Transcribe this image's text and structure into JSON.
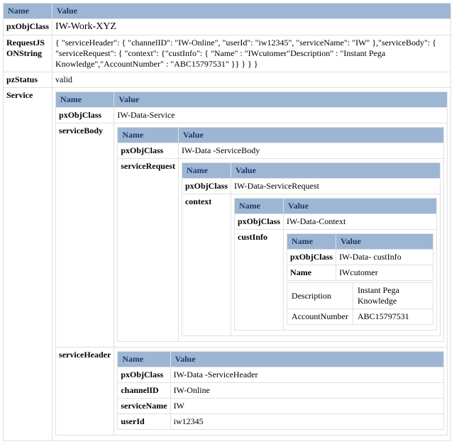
{
  "headers": {
    "name": "Name",
    "value": "Value"
  },
  "top": {
    "pxObjClass_label": "pxObjClass",
    "pxObjClass_value": "IW-Work-XYZ",
    "request_label": "RequestJSONString",
    "request_value": "{ \"serviceHeader\": { \"channelID\": \"IW-Online\", \"userId\": \"iw12345\", \"serviceName\": \"IW\" },\"serviceBody\": { \"serviceRequest\": { \"context\": {\"custInfo\": { \"Name\" : \"IWcutomer\"Description\" : \"Instant Pega Knowledge\",\"AccountNumber\" : \"ABC15797531\" }} } } }",
    "pzStatus_label": "pzStatus",
    "pzStatus_value": "valid",
    "service_label": "Service"
  },
  "service": {
    "pxObjClass_label": "pxObjClass",
    "pxObjClass_value": "IW-Data-Service",
    "serviceBody_label": "serviceBody",
    "serviceHeader_label": "serviceHeader"
  },
  "serviceBody": {
    "pxObjClass_label": "pxObjClass",
    "pxObjClass_value": "  IW-Data -ServiceBody",
    "serviceRequest_label": "serviceRequest"
  },
  "serviceRequest": {
    "pxObjClass_label": "pxObjClass",
    "pxObjClass_value": "  IW-Data-ServiceRequest",
    "context_label": "context"
  },
  "context": {
    "pxObjClass_label": "pxObjClass",
    "pxObjClass_value": "  IW-Data-Context",
    "custInfo_label": "custInfo"
  },
  "custInfo": {
    "pxObjClass_label": "pxObjClass",
    "pxObjClass_value": "IW-Data- custInfo",
    "name_label": "Name",
    "name_value": "IWcutomer",
    "desc_label": "Description",
    "desc_value": "Instant Pega Knowledge",
    "acct_label": "AccountNumber",
    "acct_value": "ABC15797531"
  },
  "serviceHeader": {
    "pxObjClass_label": "pxObjClass",
    "pxObjClass_value": "IW-Data -ServiceHeader",
    "channelID_label": "channelID",
    "channelID_value": "IW-Online",
    "serviceName_label": "serviceName",
    "serviceName_value": "IW",
    "userId_label": "userId",
    "userId_value": "iw12345"
  }
}
